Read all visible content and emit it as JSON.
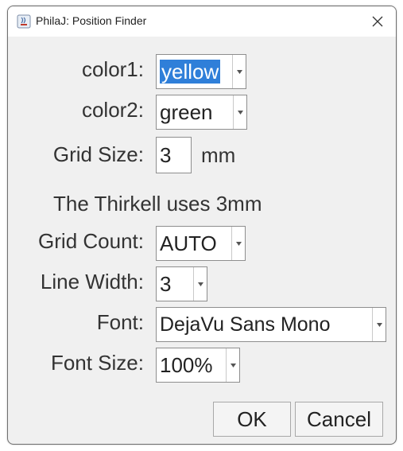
{
  "window": {
    "title": "PhilaJ: Position Finder"
  },
  "form": {
    "color1": {
      "label": "color1:",
      "value": "yellow"
    },
    "color2": {
      "label": "color2:",
      "value": "green"
    },
    "grid_size": {
      "label": "Grid Size:",
      "value": "3",
      "unit": "mm"
    },
    "note": "The Thirkell uses 3mm",
    "grid_count": {
      "label": "Grid Count:",
      "value": "AUTO"
    },
    "line_width": {
      "label": "Line Width:",
      "value": "3"
    },
    "font": {
      "label": "Font:",
      "value": "DejaVu Sans Mono"
    },
    "font_size": {
      "label": "Font Size:",
      "value": "100%"
    }
  },
  "buttons": {
    "ok": "OK",
    "cancel": "Cancel"
  },
  "colors": {
    "selection": "#2f7fd9",
    "dialog_bg": "#f0f0f0"
  }
}
